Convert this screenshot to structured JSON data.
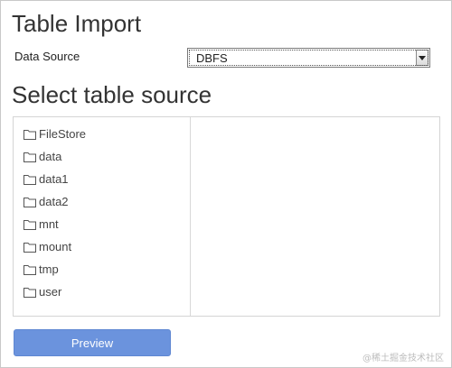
{
  "header": {
    "title": "Table Import"
  },
  "data_source": {
    "label": "Data Source",
    "selected": "DBFS",
    "arrow_icon": "chevron-down-icon"
  },
  "section": {
    "title": "Select table source"
  },
  "tree": {
    "folder_icon": "folder-icon",
    "items": [
      {
        "label": "FileStore"
      },
      {
        "label": "data"
      },
      {
        "label": "data1"
      },
      {
        "label": "data2"
      },
      {
        "label": "mnt"
      },
      {
        "label": "mount"
      },
      {
        "label": "tmp"
      },
      {
        "label": "user"
      }
    ]
  },
  "actions": {
    "preview_label": "Preview"
  },
  "watermark": {
    "text": "@稀土掘金技术社区"
  },
  "colors": {
    "primary_button": "#6b93dd",
    "border": "#d4d4d4",
    "text": "#333333"
  }
}
